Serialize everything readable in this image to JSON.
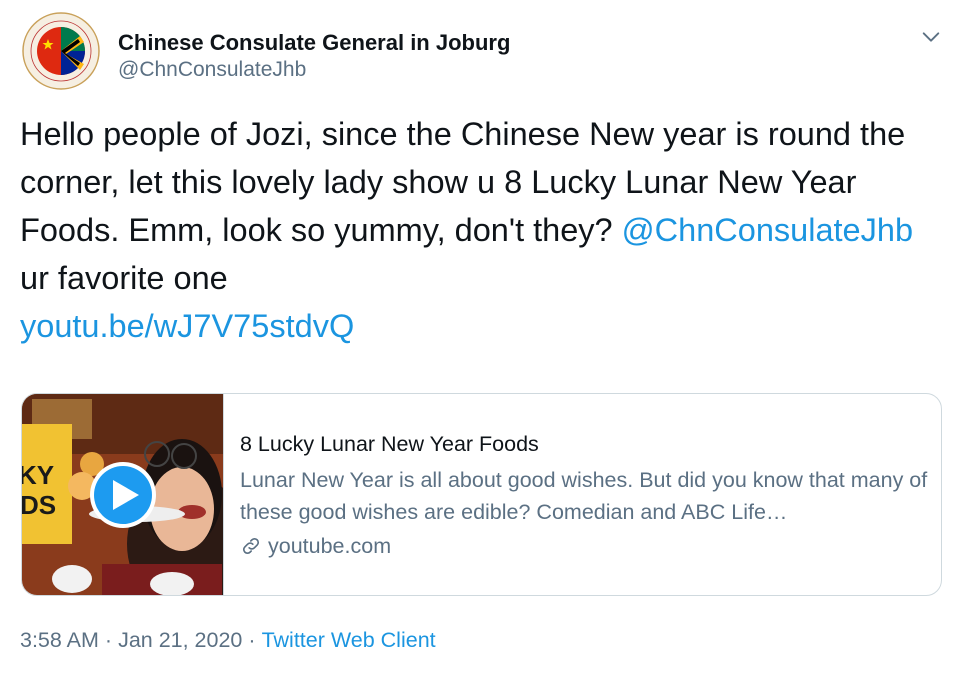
{
  "author": {
    "name": "Chinese Consulate General in Joburg",
    "handle": "@ChnConsulateJhb",
    "avatar_icon": "consulate-seal-flags-icon"
  },
  "tweet": {
    "text_part1": "Hello people of Jozi, since the Chinese New year is round the corner, let this lovely lady show u 8 Lucky Lunar New Year Foods. Emm, look so yummy, don't they? ",
    "mention": "@ChnConsulateJhb",
    "text_part2": " ur favorite one",
    "url": "youtu.be/wJ7V75stdvQ"
  },
  "card": {
    "title": "8 Lucky Lunar New Year Foods",
    "description": "Lunar New Year is all about good wishes. But did you know that many of these good wishes are edible? Comedian and ABC Life…",
    "domain": "youtube.com",
    "thumb_text_top": "KY",
    "thumb_text_bottom": "DS"
  },
  "meta": {
    "time": "3:58 AM",
    "separator": "·",
    "date": "Jan 21, 2020",
    "client": "Twitter Web Client"
  },
  "colors": {
    "link": "#1b95e0",
    "secondary_text": "#5b7083",
    "border": "#cfd9de",
    "play_button": "#1d9bf0"
  }
}
